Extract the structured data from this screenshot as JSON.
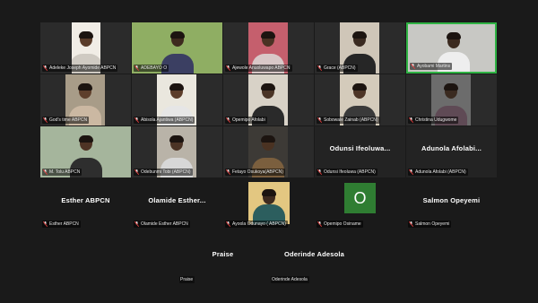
{
  "participants": [
    {
      "id": "p1",
      "name": "Adeleke Joseph Ayomide ABPCN",
      "video": true,
      "video_bg": "#f1ede6",
      "skin": "#5a3c2a",
      "shirt": "#cfcac2"
    },
    {
      "id": "p2",
      "name": "ADEBAYO O",
      "video": true,
      "video_bg": "#8fae63",
      "skin": "#3d2a1e",
      "shirt": "#3b3f62"
    },
    {
      "id": "p3",
      "name": "Ajewole Anuoluwapo ABPCN",
      "video": true,
      "video_bg": "#c55f6d",
      "skin": "#4a3224",
      "shirt": "#d9c8c8"
    },
    {
      "id": "p4",
      "name": "Grace (ABPCN)",
      "video": true,
      "video_bg": "#cfc6b8",
      "skin": "#3a2a20",
      "shirt": "#262626"
    },
    {
      "id": "p5",
      "name": "Ayobami Martins",
      "video": true,
      "video_bg": "#c8c8c4",
      "skin": "#3b2a1f",
      "shirt": "#eeeeee"
    },
    {
      "id": "p6",
      "name": "God's time ABPCN",
      "video": true,
      "video_bg": "#a89c88",
      "skin": "#5e3f2b",
      "shirt": "#cbb8a2"
    },
    {
      "id": "p7",
      "name": "Abisola Ajantiwa (ABPCN)",
      "video": true,
      "video_bg": "#eae7de",
      "skin": "#5c3d2a",
      "shirt": "#e6e6e6"
    },
    {
      "id": "p8",
      "name": "Opemipo Afolabi",
      "video": true,
      "video_bg": "#d8d2c7",
      "skin": "#4a3426",
      "shirt": "#2a2a2a"
    },
    {
      "id": "p9",
      "name": "Sobowale Zainab (ABPCN)",
      "video": true,
      "video_bg": "#d4cbbb",
      "skin": "#4d3527",
      "shirt": "#3a3a3a"
    },
    {
      "id": "p10",
      "name": "Christina Udugwome",
      "video": true,
      "video_bg": "#6c6c6c",
      "skin": "#3a2a20",
      "shirt": "#5f4a55"
    },
    {
      "id": "p11",
      "name": "M. Tolu ABPCN",
      "video": true,
      "video_bg": "#a5b59c",
      "skin": "#4e3324",
      "shirt": "#2e2e2e"
    },
    {
      "id": "p12",
      "name": "Odebunmi Tobi (ABPCN)",
      "video": true,
      "video_bg": "#b9b3a8",
      "skin": "#4b3325",
      "shirt": "#d7d7d7"
    },
    {
      "id": "p13",
      "name": "Fetayo Osukoya(ABPCN)",
      "video": true,
      "video_bg": "#3d3a36",
      "skin": "#4a3222",
      "shirt": "#7b5f3e"
    },
    {
      "id": "p14",
      "name": "Odunsi Ifeoluwa (ABPCN)",
      "big_name": "Odunsi Ifeoluwa...",
      "video": false
    },
    {
      "id": "p15",
      "name": "Adunola Afolabi (ABPCN)",
      "big_name": "Adunola Afolabi...",
      "video": false
    },
    {
      "id": "p16",
      "name": "Esther ABPCN",
      "big_name": "Esther ABPCN",
      "video": false
    },
    {
      "id": "p17",
      "name": "Olamide Esther ABPCN",
      "big_name": "Olamide Esther...",
      "video": false
    },
    {
      "id": "p18",
      "name": "Ayoola Odunayo ( ABPCN)",
      "video": true,
      "video_bg": "#e3c781",
      "skin": "#3d2a1f",
      "shirt": "#2c5e5e"
    },
    {
      "id": "p19",
      "name": "Opemipo Osiname",
      "video": false,
      "avatar_letter": "O"
    },
    {
      "id": "p20",
      "name": "Salmon Opeyemi",
      "big_name": "Salmon Opeyemi",
      "video": false
    },
    {
      "id": "p21",
      "name": "Praise",
      "big_name": "Praise",
      "video": false
    },
    {
      "id": "p22",
      "name": "Oderinde Adesola",
      "big_name": "Oderinde Adesola",
      "video": false
    }
  ],
  "colors": {
    "background": "#1a1a1a",
    "tile": "#232323",
    "active_speaker_border": "#2fb344",
    "avatar_green": "#2f7d32",
    "muted_mic": "#e23b3b"
  },
  "icons": {
    "mic": "muted-microphone-icon"
  }
}
